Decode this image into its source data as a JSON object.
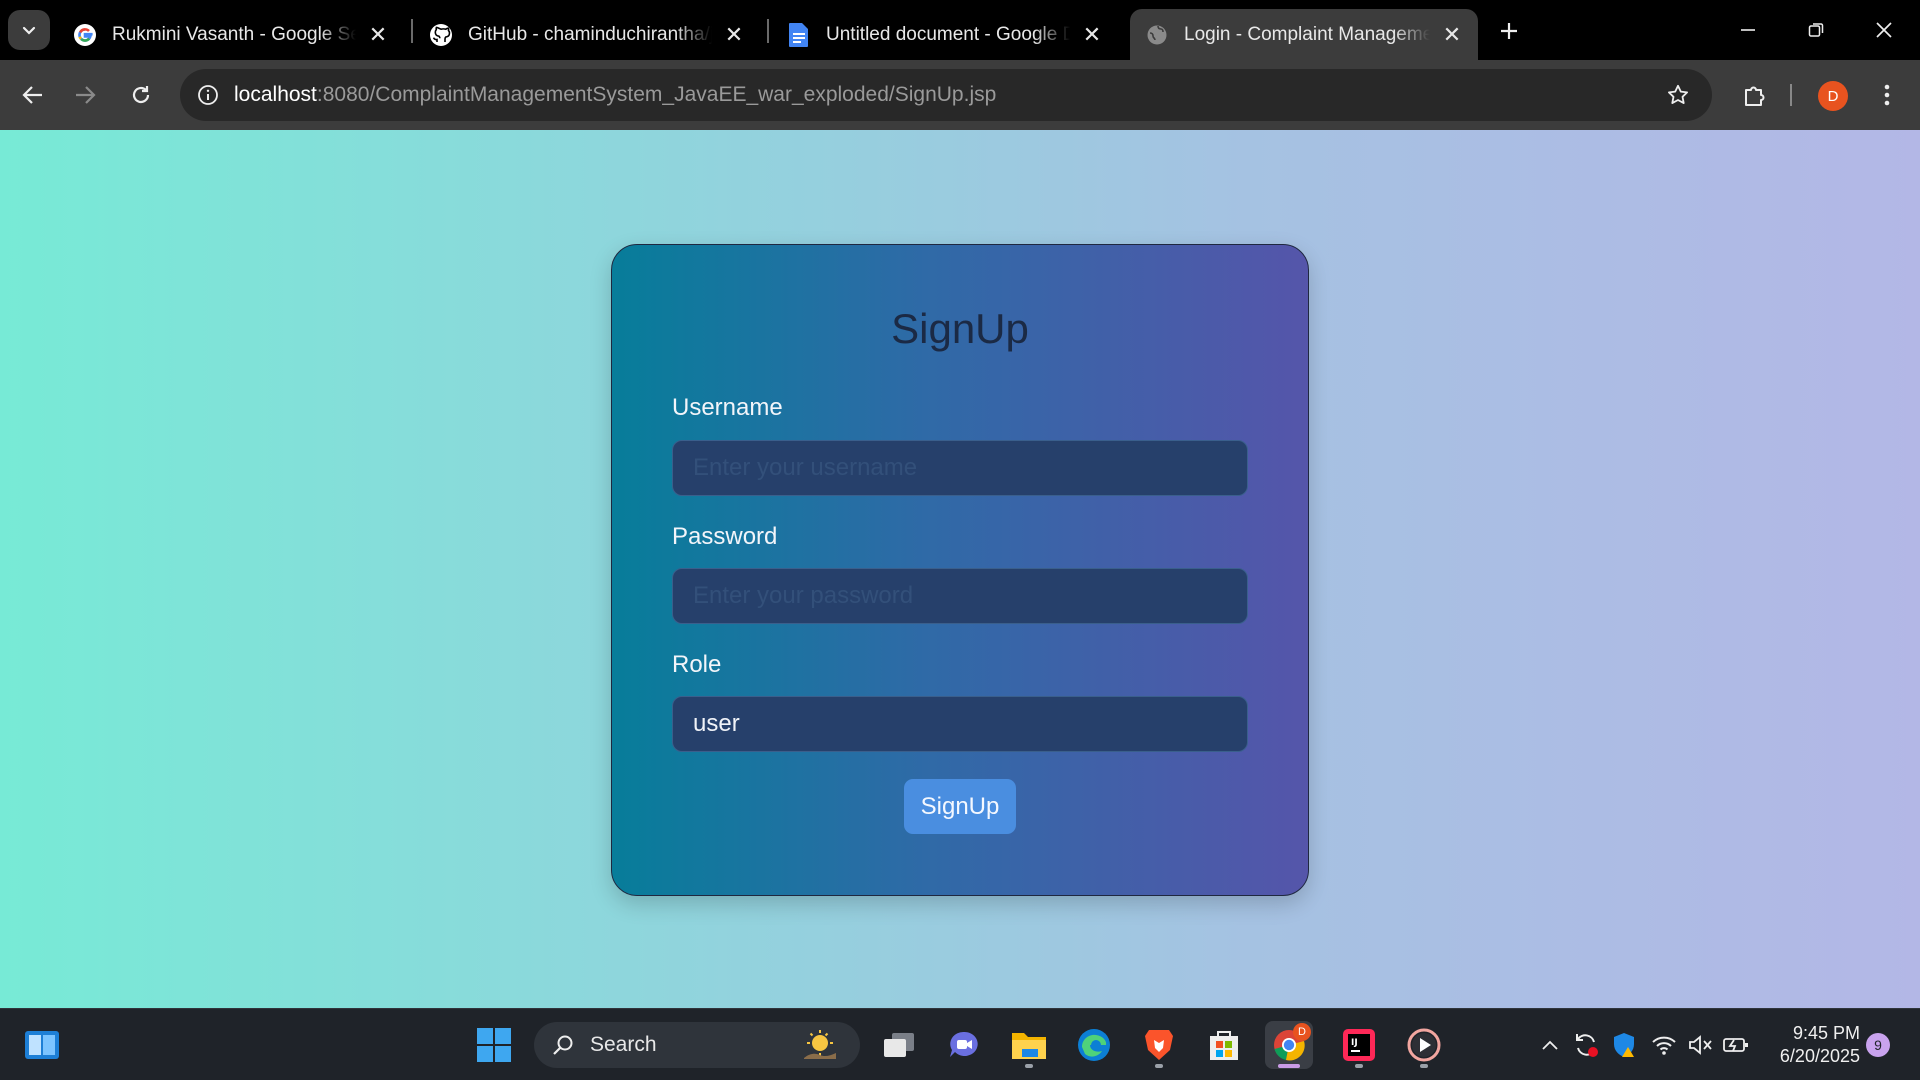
{
  "browser": {
    "tabs": [
      {
        "title": "Rukmini Vasanth - Google Search",
        "icon": "google-icon"
      },
      {
        "title": "GitHub - chaminduchirantha/java",
        "icon": "github-icon"
      },
      {
        "title": "Untitled document - Google Docs",
        "icon": "google-docs-icon"
      },
      {
        "title": "Login - Complaint Management",
        "icon": "globe-icon",
        "active": true
      }
    ],
    "url_host": "localhost",
    "url_path": ":8080/ComplaintManagementSystem_JavaEE_war_exploded/SignUp.jsp",
    "profile_initial": "D"
  },
  "page": {
    "title": "SignUp",
    "username_label": "Username",
    "username_placeholder": "Enter your username",
    "password_label": "Password",
    "password_placeholder": "Enter your password",
    "role_label": "Role",
    "role_value": "user",
    "submit_label": "SignUp"
  },
  "taskbar": {
    "search_label": "Search",
    "time": "9:45 PM",
    "date": "6/20/2025",
    "notification_count": "9",
    "chrome_badge": "D"
  },
  "colors": {
    "page_gradient_start": "#77ead6",
    "page_gradient_end": "#b3b7e6",
    "card_gradient_start": "#077d9a",
    "card_gradient_end": "#5555aa",
    "button": "#4a8ee0",
    "profile": "#e8531f"
  }
}
